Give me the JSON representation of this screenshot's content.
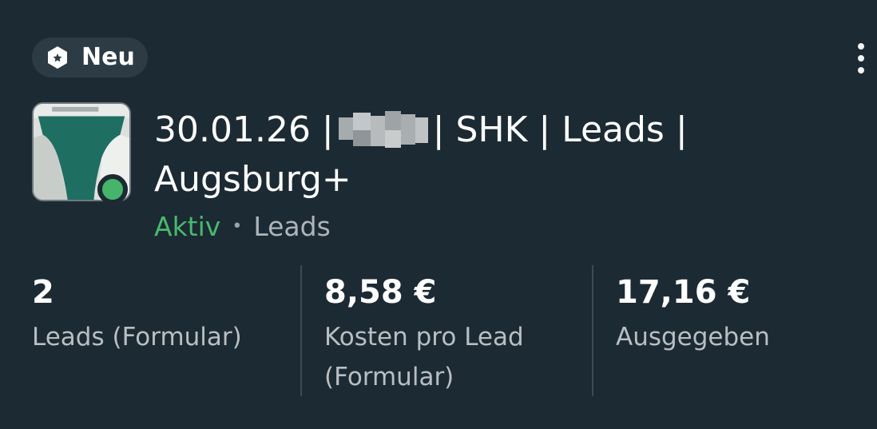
{
  "badge": {
    "label": "Neu",
    "icon": "hexagon-star-icon"
  },
  "menu": {
    "icon": "more-vertical-icon"
  },
  "campaign": {
    "title_prefix": "30.01.26 |",
    "title_suffix": "| SHK | Leads | Augsburg+",
    "status": "Aktiv",
    "separator": "•",
    "type": "Leads",
    "status_color": "#48b96d"
  },
  "stats": [
    {
      "value": "2",
      "label": "Leads (Formular)"
    },
    {
      "value": "8,58 €",
      "label": "Kosten pro Lead (Formular)"
    },
    {
      "value": "17,16 €",
      "label": "Ausgegeben"
    }
  ],
  "colors": {
    "background": "#1c2a33",
    "badge_bg": "#2c3b44",
    "active_dot": "#46b46b"
  }
}
